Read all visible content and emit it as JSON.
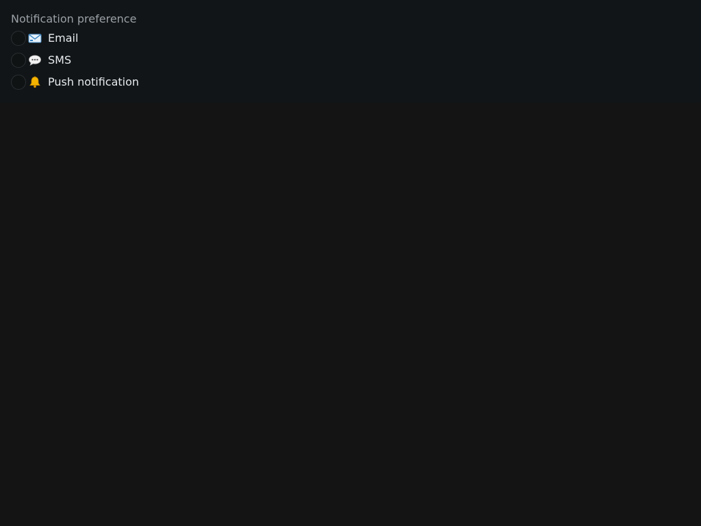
{
  "group": {
    "label": "Notification preference",
    "selected": null
  },
  "options": [
    {
      "label": "Email",
      "icon": "envelope-icon"
    },
    {
      "label": "SMS",
      "icon": "speech-bubble-icon"
    },
    {
      "label": "Push notification",
      "icon": "bell-icon"
    }
  ],
  "colors": {
    "background": "#141414",
    "panel": "#111517",
    "label": "#9aa0a6",
    "text": "#e8eaed"
  }
}
